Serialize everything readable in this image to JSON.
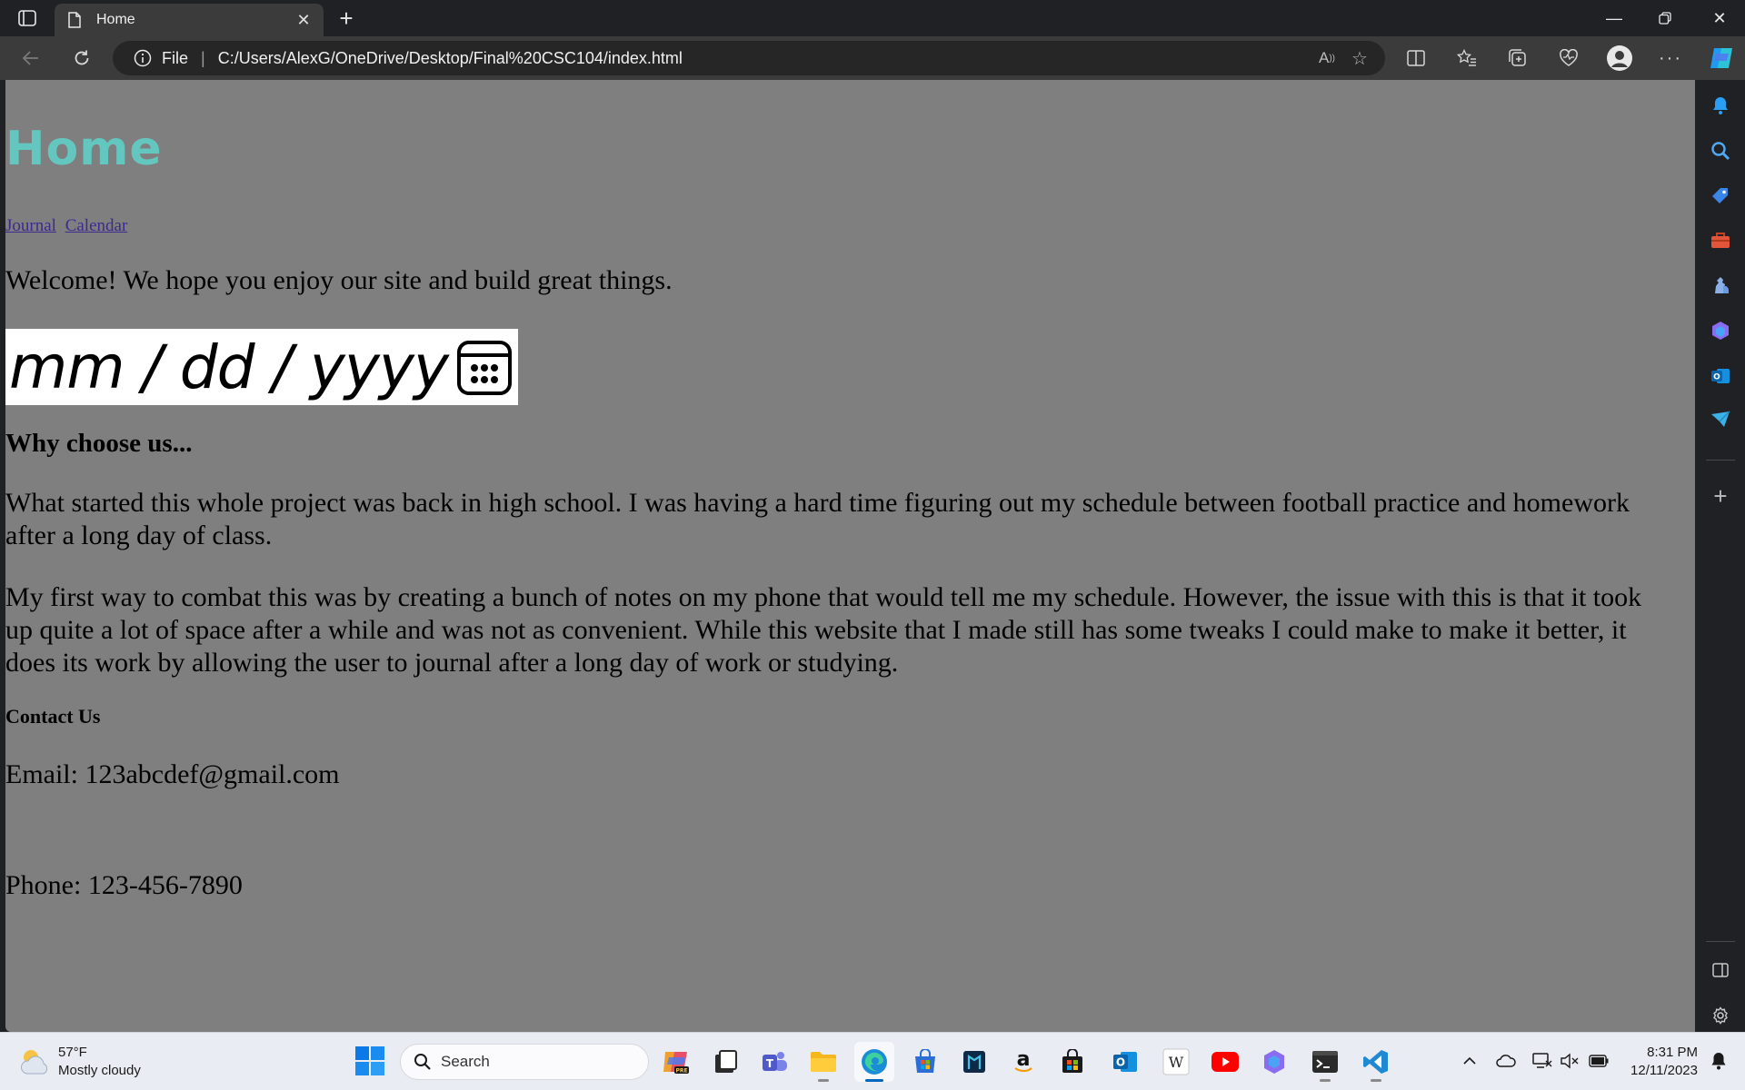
{
  "browser": {
    "tab_title": "Home",
    "address_scheme": "File",
    "address_url": "C:/Users/AlexG/OneDrive/Desktop/Final%20CSC104/index.html"
  },
  "page": {
    "heading": "Home",
    "nav_links": [
      "Journal",
      "Calendar"
    ],
    "welcome": "Welcome! We hope you enjoy our site and build great things.",
    "date_input_placeholder": "mm / dd / yyyy",
    "why_heading": "Why choose us...",
    "paragraph_1": "What started this whole project was back in high school. I was having a hard time figuring out my schedule between football practice and homework after a long day of class.",
    "paragraph_2": "My first way to combat this was by creating a bunch of notes on my phone that would tell me my schedule. However, the issue with this is that it took up quite a lot of space after a while and was not as convenient. While this website that I made still has some tweaks I could make to make it better, it does its work by allowing the user to journal after a long day of work or studying.",
    "contact_heading": "Contact Us",
    "email": "Email: 123abcdef@gmail.com",
    "phone": "Phone: 123-456-7890"
  },
  "taskbar": {
    "weather_temp": "57°F",
    "weather_desc": "Mostly cloudy",
    "search_placeholder": "Search",
    "time": "8:31 PM",
    "date": "12/11/2023"
  },
  "colors": {
    "page_background": "#7f7f7f",
    "heading": "#63c7c0",
    "link": "#3d2a8f",
    "browser_chrome": "#202124",
    "taskbar": "#e9ecf3"
  },
  "icons": {
    "sidebar": [
      "bell-icon",
      "search-icon",
      "tag-icon",
      "toolbox-icon",
      "chess-icon",
      "copilot-icon",
      "outlook-icon",
      "send-icon",
      "add-icon",
      "split-panel-icon",
      "settings-icon"
    ],
    "taskbar_apps": [
      "copilot-app-icon",
      "file-manager-icon",
      "teams-icon",
      "file-explorer-icon",
      "edge-icon",
      "microsoft-store-icon",
      "app-icon",
      "amazon-icon",
      "store-bag-icon",
      "outlook-icon",
      "wikipedia-icon",
      "youtube-icon",
      "copilot-icon",
      "terminal-icon",
      "vscode-icon"
    ]
  }
}
